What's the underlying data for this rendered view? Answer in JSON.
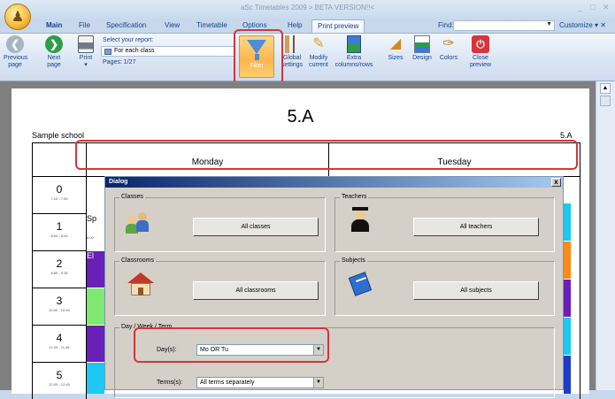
{
  "window": {
    "title": "aSc Timetables 2009  > BETA VERSION!!<",
    "controls": [
      "_",
      "□",
      "✕"
    ]
  },
  "app_button": {
    "icon": "asc-logo-icon"
  },
  "tabs": [
    {
      "label": "Main",
      "active": false
    },
    {
      "label": "File",
      "active": false
    },
    {
      "label": "Specification",
      "active": false
    },
    {
      "label": "View",
      "active": false
    },
    {
      "label": "Timetable",
      "active": false
    },
    {
      "label": "Options",
      "active": false
    },
    {
      "label": "Help",
      "active": false
    },
    {
      "label": "Print preview",
      "active": true
    }
  ],
  "find": {
    "label": "Find:",
    "value": ""
  },
  "customize": {
    "label": "Customize ▾ ✕"
  },
  "ribbon": {
    "previous": {
      "label1": "Previous",
      "label2": "page",
      "icon": "arrow-left-icon"
    },
    "next": {
      "label1": "Next",
      "label2": "page",
      "icon": "arrow-right-icon"
    },
    "print": {
      "label1": "Print",
      "label2": "▾",
      "icon": "printer-icon"
    },
    "report_label": "Select your report:",
    "report_value": "For each class",
    "pages": "Pages: 1/27",
    "filter": {
      "label": "Filter",
      "icon": "filter-icon"
    },
    "global": {
      "label1": "Global",
      "label2": "settings",
      "icon": "global-settings-icon"
    },
    "modify": {
      "label1": "Modify",
      "label2": "current",
      "icon": "modify-icon"
    },
    "extra": {
      "label1": "Extra",
      "label2": "columns/rows",
      "icon": "extra-columns-icon"
    },
    "sizes": {
      "label": "Sizes",
      "icon": "sizes-icon"
    },
    "design": {
      "label": "Design",
      "icon": "design-icon"
    },
    "colors": {
      "label": "Colors",
      "icon": "colors-icon"
    },
    "close": {
      "label1": "Close",
      "label2": "preview",
      "icon": "power-icon"
    }
  },
  "preview": {
    "class_title": "5.A",
    "school": "Sample school",
    "class_code": "5.A",
    "days": [
      "Monday",
      "Tuesday"
    ],
    "periods": [
      {
        "num": "0",
        "time": "7:10 - 7:55"
      },
      {
        "num": "1",
        "time": "8:00 - 8:45"
      },
      {
        "num": "2",
        "time": "8:50 - 9:35"
      },
      {
        "num": "3",
        "time": "10:00 - 10:45"
      },
      {
        "num": "4",
        "time": "11:00 - 11:45"
      },
      {
        "num": "5",
        "time": "12:00 - 12:45"
      }
    ],
    "partial_cells": [
      {
        "text": "Sp",
        "sub": "8:00"
      },
      {
        "text": "El",
        "sub": ""
      }
    ],
    "colors": {
      "purple": "#6a1fb7",
      "green": "#80e873",
      "cyan": "#1ec8f0",
      "orange": "#ff8a1a",
      "blue": "#1f3cc9"
    }
  },
  "dialog": {
    "title": "Dialog",
    "close": "x",
    "groups": {
      "classes": {
        "label": "Classes",
        "button": "All classes",
        "icon": "classes-icon"
      },
      "teachers": {
        "label": "Teachers",
        "button": "All teachers",
        "icon": "teacher-icon"
      },
      "classrooms": {
        "label": "Classrooms",
        "button": "All classrooms",
        "icon": "classroom-icon"
      },
      "subjects": {
        "label": "Subjects",
        "button": "All subjects",
        "icon": "subjects-icon"
      },
      "dwt": {
        "label": "Day / Week / Term"
      }
    },
    "days_label": "Day(s):",
    "days_value": "Mo OR Tu",
    "terms_label": "Terms(s):",
    "terms_value": "All terms separately"
  }
}
